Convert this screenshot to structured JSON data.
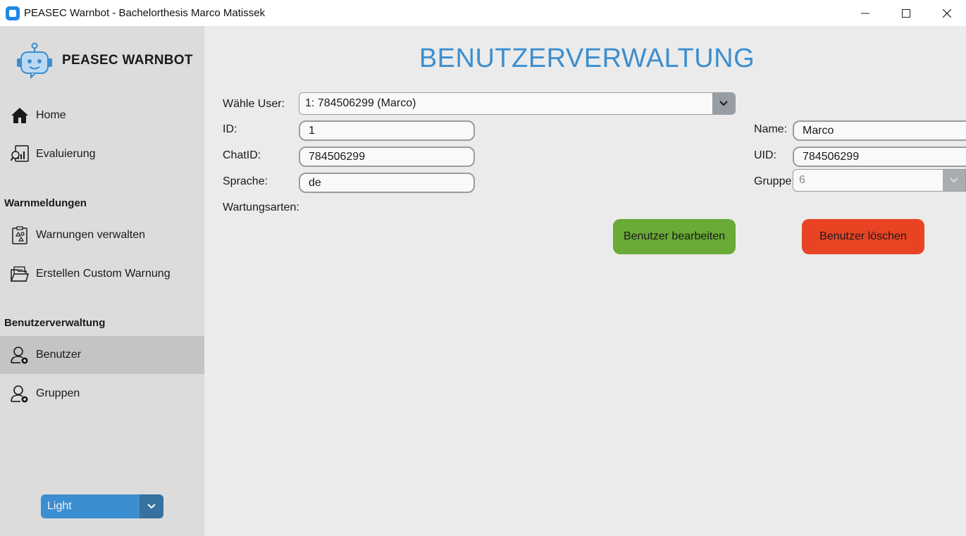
{
  "window": {
    "title": "PEASEC Warnbot - Bachelorthesis Marco Matissek",
    "minimize": "—",
    "maximize": "☐",
    "close": "✕"
  },
  "sidebar": {
    "brand": "PEASEC WARNBOT",
    "items": [
      {
        "label": "Home",
        "icon": "home-icon"
      },
      {
        "label": "Evaluierung",
        "icon": "evaluation-icon"
      }
    ],
    "sections": [
      {
        "title": "Warnmeldungen",
        "items": [
          {
            "label": "Warnungen verwalten",
            "icon": "warnings-icon"
          },
          {
            "label": "Erstellen Custom Warnung",
            "icon": "create-warning-icon"
          }
        ]
      },
      {
        "title": "Benutzerverwaltung",
        "items": [
          {
            "label": "Benutzer",
            "icon": "user-icon",
            "active": true
          },
          {
            "label": "Gruppen",
            "icon": "group-icon"
          }
        ]
      }
    ],
    "theme": {
      "value": "Light"
    }
  },
  "main": {
    "title": "BENUTZERVERWALTUNG",
    "select_user": {
      "label": "Wähle User:",
      "value": "1: 784506299 (Marco)"
    },
    "id": {
      "label": "ID:",
      "value": "1"
    },
    "chat_id": {
      "label": "ChatID:",
      "value": "784506299"
    },
    "language": {
      "label": "Sprache:",
      "value": "de"
    },
    "warning_types": {
      "label": "Wartungsarten:"
    },
    "name": {
      "label": "Name:",
      "value": "Marco"
    },
    "uid": {
      "label": "UID:",
      "value": "784506299"
    },
    "group": {
      "label": "Gruppe:",
      "value": "6"
    },
    "edit_button": "Benutzer bearbeiten",
    "delete_button": "Benutzer löschen"
  },
  "colors": {
    "accent": "#3b8ed0",
    "edit": "#6aaa36",
    "delete": "#e84424",
    "sidebar_bg": "#dcdcdc",
    "active_item": "#c4c4c4"
  }
}
